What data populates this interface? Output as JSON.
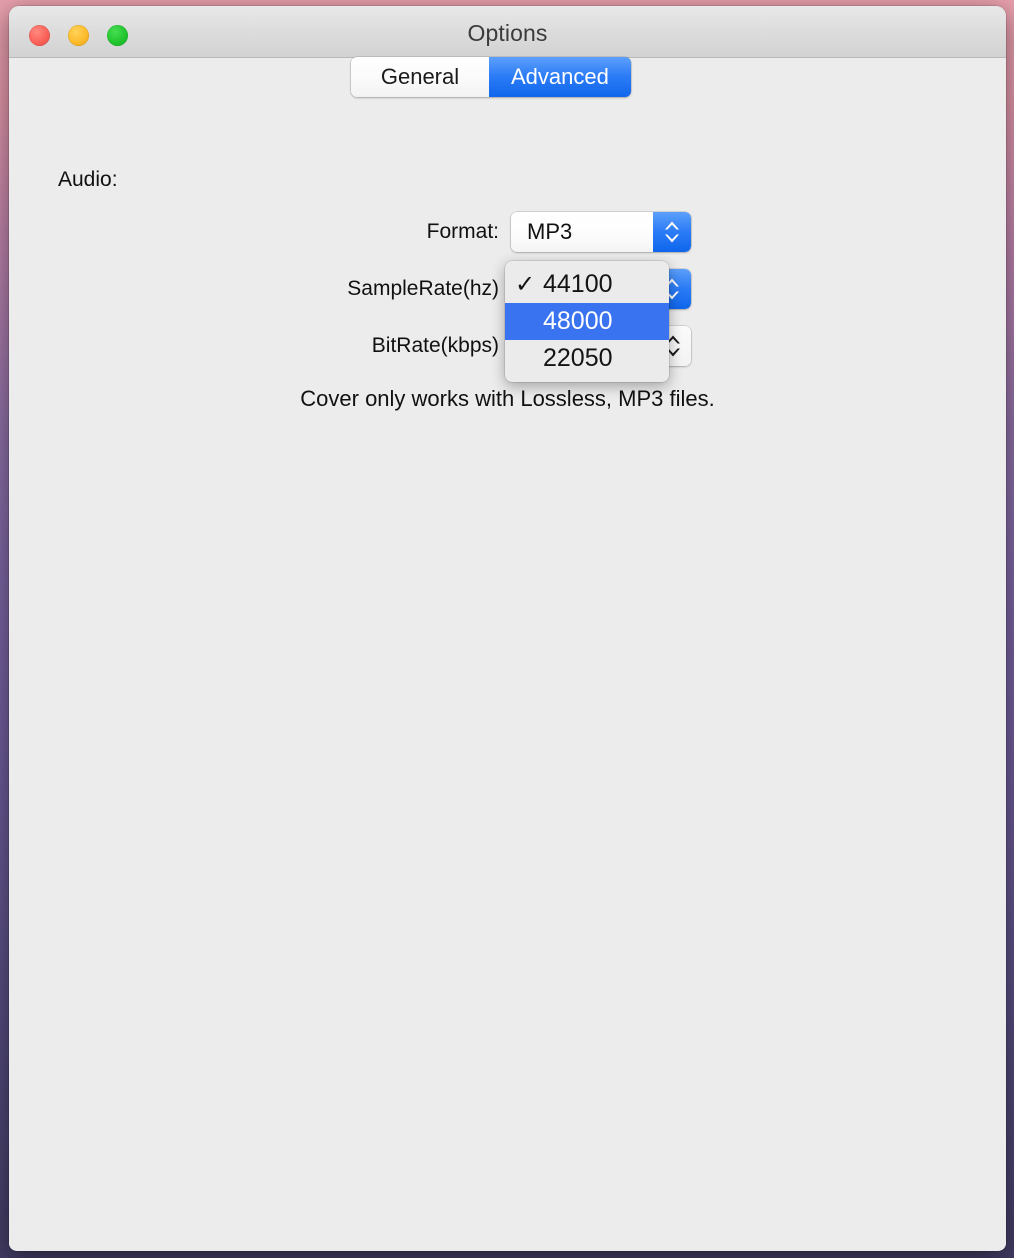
{
  "window": {
    "title": "Options",
    "traffic_lights": [
      {
        "name": "close",
        "color": "#fa6158"
      },
      {
        "name": "minimize",
        "color": "#fcbb2c"
      },
      {
        "name": "zoom",
        "color": "#22c52e"
      }
    ]
  },
  "tabs": [
    {
      "label": "General",
      "active": false
    },
    {
      "label": "Advanced",
      "active": true
    }
  ],
  "section": {
    "audio_label": "Audio:"
  },
  "fields": [
    {
      "label": "Format:",
      "value": "MP3",
      "arrow_style": "blue"
    },
    {
      "label": "SampleRate(hz)",
      "value": "44100",
      "arrow_style": "blue"
    },
    {
      "label": "BitRate(kbps)",
      "value": "",
      "arrow_style": "plain"
    }
  ],
  "popup_menu": {
    "open_for": "SampleRate(hz)",
    "items": [
      {
        "label": "44100",
        "checked": true,
        "highlighted": false
      },
      {
        "label": "48000",
        "checked": false,
        "highlighted": true
      },
      {
        "label": "22050",
        "checked": false,
        "highlighted": false
      }
    ],
    "check_glyph": "✓"
  },
  "note": "Cover only works with Lossless, MP3 files.",
  "colors": {
    "accent_blue": "#2c7cf6",
    "menu_highlight": "#3a73f0",
    "window_bg": "#ececec",
    "titlebar_bg": "#dcdcdc"
  }
}
